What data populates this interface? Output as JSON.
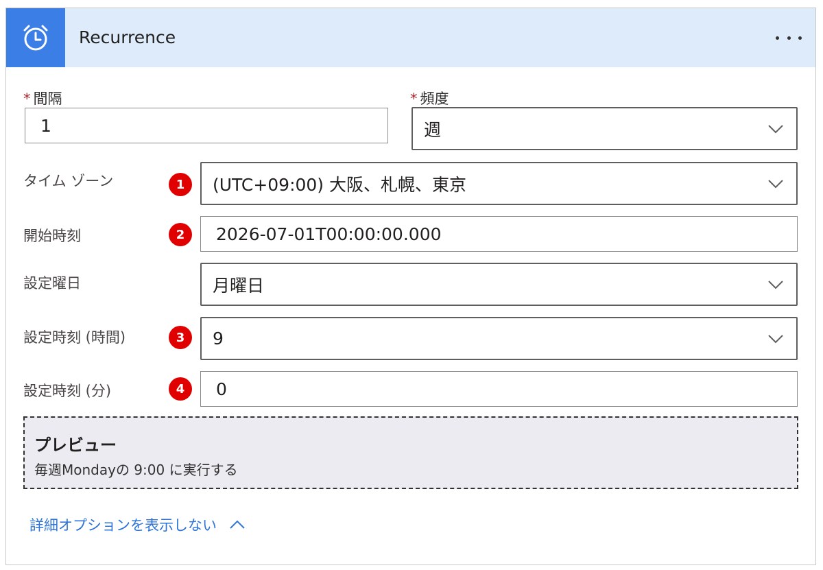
{
  "header": {
    "title": "Recurrence",
    "icon": "alarm-clock-icon",
    "more_icon": "more-ellipsis-icon",
    "background": "#deebfb",
    "icon_background": "#3a7ee6"
  },
  "fields": {
    "interval": {
      "label": "間隔",
      "required": "*",
      "value": "1"
    },
    "frequency": {
      "label": "頻度",
      "required": "*",
      "value": "週"
    },
    "timezone": {
      "label": "タイム ゾーン",
      "badge": "1",
      "value": "(UTC+09:00) 大阪、札幌、東京"
    },
    "start_time": {
      "label": "開始時刻",
      "badge": "2",
      "value": "2026-07-01T00:00:00.000"
    },
    "weekday": {
      "label": "設定曜日",
      "value": "月曜日"
    },
    "hours": {
      "label": "設定時刻 (時間)",
      "badge": "3",
      "value": "9"
    },
    "minutes": {
      "label": "設定時刻 (分)",
      "badge": "4",
      "value": "0"
    }
  },
  "preview": {
    "title": "プレビュー",
    "text": "毎週Mondayの 9:00 に実行する"
  },
  "advanced": {
    "label": "詳細オプションを表示しない",
    "icon": "chevron-up-icon"
  },
  "colors": {
    "badge": "#e00000",
    "link": "#2f74d6",
    "required": "#a4262c"
  }
}
